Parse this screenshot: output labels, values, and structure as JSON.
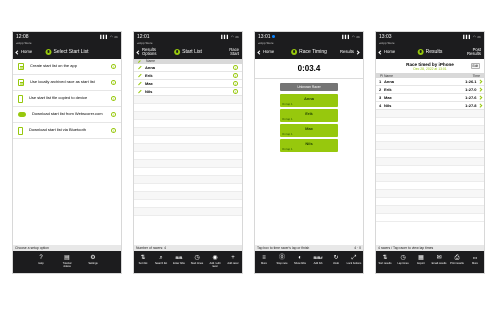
{
  "screens": [
    {
      "statusbar": {
        "time": "12:08",
        "signal": "▌▌▌ ◠ ▭"
      },
      "app_back": "◂ App Store",
      "nav": {
        "back": "Home",
        "title": "Select Start List",
        "right": ""
      },
      "items": [
        {
          "label": "Create start list on the app",
          "icon": "document-icon"
        },
        {
          "label": "Use locally archived race as start list",
          "icon": "archive-icon"
        },
        {
          "label": "Use start list file copied to device",
          "icon": "device-file-icon"
        },
        {
          "label": "Download start list from Webscorer.com",
          "icon": "cloud-download-icon"
        },
        {
          "label": "Download start list via Bluetooth",
          "icon": "bluetooth-icon"
        }
      ],
      "status_left": "Choose a setup option",
      "status_right": "",
      "toolbar": [
        {
          "icon": "?",
          "label": "Help",
          "name": "help-icon"
        },
        {
          "icon": "▤",
          "label": "Tutorial videos",
          "name": "video-icon"
        },
        {
          "icon": "⚙",
          "label": "Settings",
          "name": "gear-icon"
        }
      ]
    },
    {
      "statusbar": {
        "time": "12:01",
        "signal": "▌▌▌ ◠ ▭"
      },
      "app_back": "◂ App Store",
      "nav": {
        "back": "Results Options",
        "title": "Start List",
        "right": "Race Start"
      },
      "header": "Name",
      "names": [
        "Anna",
        "Erik",
        "Max",
        "Nils"
      ],
      "status_left": "Number of racers: 4",
      "status_right": "",
      "toolbar": [
        {
          "icon": "⇅",
          "label": "Sort list",
          "name": "sort-icon"
        },
        {
          "icon": "⌕",
          "label": "Search list",
          "name": "search-icon"
        },
        {
          "icon": "BIB",
          "label": "Enter bibs",
          "name": "bib-icon"
        },
        {
          "icon": "◷",
          "label": "Start times",
          "name": "clock-icon"
        },
        {
          "icon": "◉",
          "label": "Add / edit racer",
          "name": "racer-icon"
        },
        {
          "icon": "+",
          "label": "Add racer",
          "name": "add-icon"
        }
      ]
    },
    {
      "statusbar": {
        "time": "13:01",
        "signal": "▌▌▌ ◠ ▭"
      },
      "app_back": "◂ App Store",
      "nav": {
        "back": "Home",
        "title": "Race Timing",
        "right": "Results"
      },
      "time": "0:03.4",
      "unknown_label": "Unknown Racer",
      "runners": [
        {
          "name": "Anna",
          "lap": "On lap 1"
        },
        {
          "name": "Erik",
          "lap": "On lap 1"
        },
        {
          "name": "Max",
          "lap": "On lap 1"
        },
        {
          "name": "Nils",
          "lap": "On lap 1"
        }
      ],
      "status_left": "Tap box to time racer's lap or finish",
      "status_right": "4 · 0",
      "toolbar": [
        {
          "icon": "≡",
          "label": "More",
          "name": "menu-icon"
        },
        {
          "icon": "⓪",
          "label": "Stop race",
          "name": "stop-icon"
        },
        {
          "icon": "◐",
          "label": "Show bibs",
          "name": "bib-icon"
        },
        {
          "icon": "BIB#",
          "label": "Add bib",
          "name": "add-bib-icon"
        },
        {
          "icon": "↻",
          "label": "Undo",
          "name": "undo-icon"
        },
        {
          "icon": "⤢",
          "label": "Lock buttons",
          "name": "lock-icon"
        }
      ]
    },
    {
      "statusbar": {
        "time": "13:03",
        "signal": "▌▌▌ ◠ ▭"
      },
      "app_back": "◂ App Store",
      "nav": {
        "back": "Home",
        "title": "Results",
        "right": "Post Results"
      },
      "race_title": "Race timed by iPhone",
      "race_date": "Dec 28, 2022 at 13:01",
      "edit_label": "Edit",
      "header_left": "Pl  Name",
      "header_right": "Time",
      "results": [
        {
          "place": "1",
          "name": "Anna",
          "time": "1:26.1"
        },
        {
          "place": "2",
          "name": "Erik",
          "time": "1:27.0"
        },
        {
          "place": "3",
          "name": "Max",
          "time": "1:27.6"
        },
        {
          "place": "4",
          "name": "Nils",
          "time": "1:27.8"
        }
      ],
      "status_left": "4 racers / Tap racer to view lap times",
      "status_right": "",
      "toolbar": [
        {
          "icon": "⇅",
          "label": "Sort results",
          "name": "sort-icon"
        },
        {
          "icon": "◷",
          "label": "Lap times",
          "name": "clock-icon"
        },
        {
          "icon": "▦",
          "label": "Export",
          "name": "export-icon"
        },
        {
          "icon": "✉",
          "label": "Email results",
          "name": "email-icon"
        },
        {
          "icon": "⎙",
          "label": "Print results",
          "name": "print-icon"
        },
        {
          "icon": "•••",
          "label": "More",
          "name": "more-icon"
        }
      ]
    }
  ]
}
